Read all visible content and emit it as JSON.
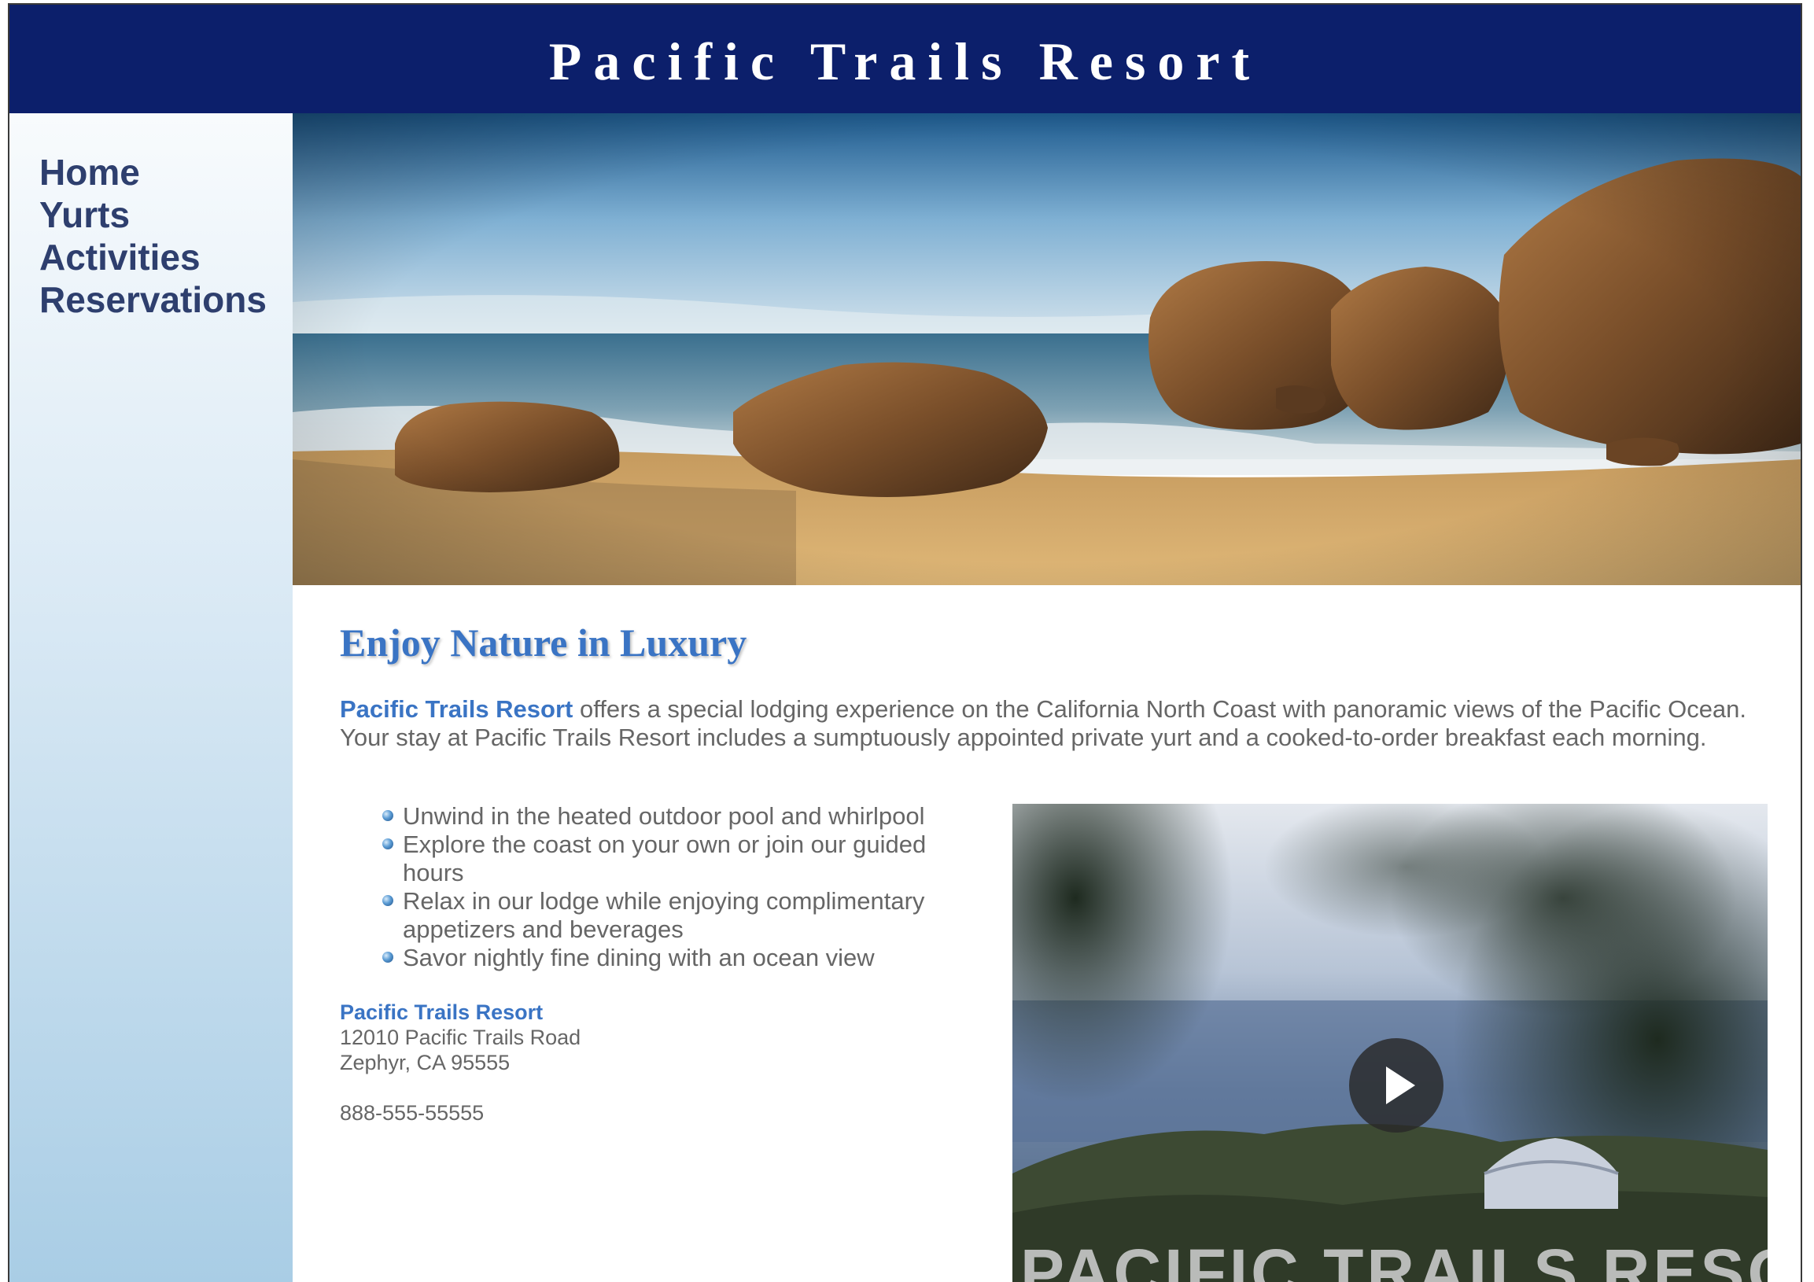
{
  "header": {
    "title": "Pacific Trails Resort"
  },
  "nav": {
    "items": [
      {
        "label": "Home"
      },
      {
        "label": "Yurts"
      },
      {
        "label": "Activities"
      },
      {
        "label": "Reservations"
      }
    ]
  },
  "main": {
    "heading": "Enjoy Nature in Luxury",
    "intro": {
      "brand": "Pacific Trails Resort",
      "text": " offers a special lodging experience on the California North Coast with panoramic views of the Pacific Ocean. Your stay at Pacific Trails Resort includes a sumptuously appointed private yurt and a cooked-to-order breakfast each morning."
    },
    "features": [
      "Unwind in the heated outdoor pool and whirlpool",
      "Explore the coast on your own or join our guided hours",
      "Relax in our lodge while enjoying complimentary appetizers and beverages",
      "Savor nightly fine dining with an ocean view"
    ],
    "address": {
      "name": "Pacific Trails Resort",
      "street": "12010 Pacific Trails Road",
      "city": "Zephyr, CA 95555",
      "phone": "888-555-55555"
    }
  },
  "video": {
    "overlay_text": "PACIFIC TRAILS RESORT",
    "play_icon": "play-icon"
  },
  "colors": {
    "header_bg": "#0c1f6b",
    "nav_text": "#2e3f6e",
    "accent": "#3a74c4",
    "body_text": "#666666"
  }
}
